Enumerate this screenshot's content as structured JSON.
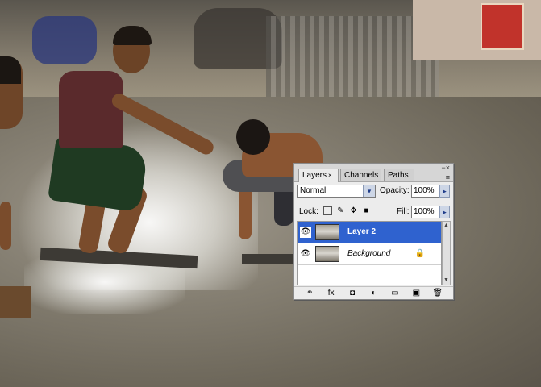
{
  "layers_panel": {
    "tabs": [
      {
        "label": "Layers",
        "close": "×",
        "active": true
      },
      {
        "label": "Channels",
        "active": false
      },
      {
        "label": "Paths",
        "active": false
      }
    ],
    "window_controls": "−×",
    "panel_menu": "≡",
    "blend_mode": "Normal",
    "opacity_label": "Opacity:",
    "opacity_value": "100%",
    "lock_label": "Lock:",
    "fill_label": "Fill:",
    "fill_value": "100%",
    "layers": [
      {
        "name": "Layer 2",
        "selected": true,
        "visible": true
      },
      {
        "name": "Background",
        "selected": false,
        "visible": true,
        "locked": true
      }
    ],
    "footer_icons": [
      "link-icon",
      "fx-icon",
      "mask-icon",
      "adjustment-icon",
      "folder-icon",
      "new-layer-icon",
      "trash-icon"
    ],
    "footer_glyphs": [
      "⚭",
      "fx",
      "◘",
      "◐",
      "▭",
      "▣",
      "🗑"
    ]
  }
}
